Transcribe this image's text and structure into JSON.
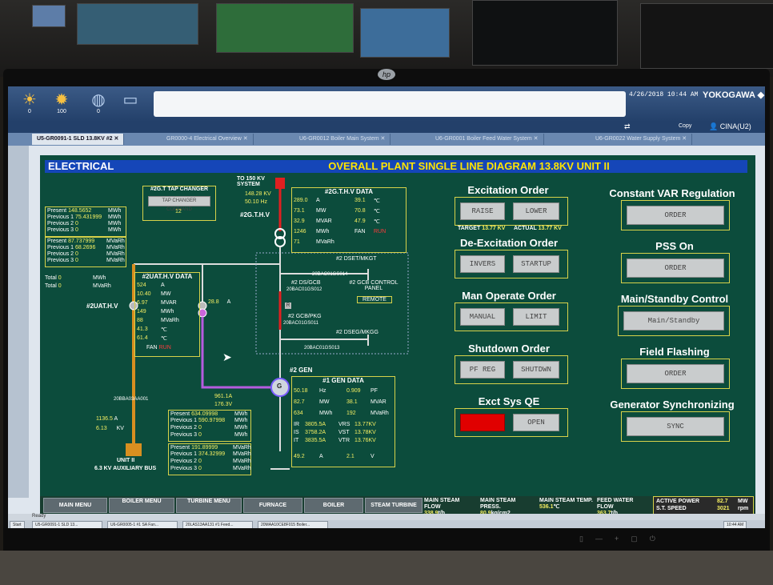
{
  "app": {
    "brand": "YOKOGAWA ◆",
    "clock": "4/26/2018 10:44 AM",
    "copy_label": "Copy",
    "user": "CINA(U2)",
    "toolbar": [
      {
        "icon": "alarm-sun-icon",
        "value": "0"
      },
      {
        "icon": "alarm-sun-icon",
        "value": "100"
      },
      {
        "icon": "operator-icon",
        "value": "0"
      },
      {
        "icon": "message-icon",
        "value": ""
      }
    ]
  },
  "tabs": [
    {
      "label": "U5-GR0091-1 SLD 13.8KV #2 ✕",
      "active": true
    },
    {
      "label": "GR0000-4 Electrical Overview ✕",
      "active": false
    },
    {
      "label": "U6-GR0012 Boiler Main System ✕",
      "active": false
    },
    {
      "label": "U6-GR0001 Boiler Feed Water System ✕",
      "active": false
    },
    {
      "label": "U6-GR0022 Water Supply System ✕",
      "active": false
    }
  ],
  "graphic": {
    "header_left": "ELECTRICAL",
    "header_title": "OVERALL PLANT SINGLE LINE DIAGRAM 13.8KV UNIT II",
    "top_system": "TO 150 KV SYSTEM",
    "top_kv": "148.28",
    "top_kv_unit": "KV",
    "top_hz": "50.10",
    "top_hz_unit": "Hz",
    "gthv_label": "#2G.T.H.V",
    "tap": {
      "title": "#2G.T TAP CHANGER",
      "button": "TAP CHANGER COMMAND",
      "value": "12"
    },
    "energy_mwh": [
      {
        "label": "Present",
        "value": "148.5652",
        "unit": "MWh"
      },
      {
        "label": "Previous 1",
        "value": "75.431999",
        "unit": "MWh"
      },
      {
        "label": "Previous 2",
        "value": "0",
        "unit": "MWh"
      },
      {
        "label": "Previous 3",
        "value": "0",
        "unit": "MWh"
      }
    ],
    "energy_mvarh": [
      {
        "label": "Present",
        "value": "87.737999",
        "unit": "MVaRh"
      },
      {
        "label": "Previous 1",
        "value": "68.2696",
        "unit": "MVaRh"
      },
      {
        "label": "Previous 2",
        "value": "0",
        "unit": "MVaRh"
      },
      {
        "label": "Previous 3",
        "value": "0",
        "unit": "MVaRh"
      }
    ],
    "totals": [
      {
        "label": "Total",
        "value": "0",
        "unit": "MWh"
      },
      {
        "label": "Total",
        "value": "0",
        "unit": "MVaRh"
      }
    ],
    "gthv_data": {
      "title": "#2G.T.H.V DATA",
      "rows": [
        {
          "v1": "289.0",
          "u1": "A",
          "v2": "39.1",
          "u2": "℃"
        },
        {
          "v1": "73.1",
          "u1": "MW",
          "v2": "70.8",
          "u2": "℃"
        },
        {
          "v1": "32.9",
          "u1": "MVAR",
          "v2": "47.9",
          "u2": "℃"
        },
        {
          "v1": "1246",
          "u1": "MWh",
          "v2": "FAN",
          "u2": "RUN"
        },
        {
          "v1": "71",
          "u1": "MVaRh",
          "v2": "",
          "u2": ""
        }
      ]
    },
    "uathv_data": {
      "title": "#2UAT.H.V DATA",
      "rows": [
        {
          "v": "524",
          "u": "A"
        },
        {
          "v": "10.40",
          "u": "MW"
        },
        {
          "v": "6.97",
          "u": "MVAR"
        },
        {
          "v": "149",
          "u": "MWh"
        },
        {
          "v": "88",
          "u": "MVaRh"
        },
        {
          "v": "41.3",
          "u": "℃"
        },
        {
          "v": "61.4",
          "u": "℃"
        },
        {
          "v": "FAN",
          "u": "RUN"
        }
      ]
    },
    "uathv_label": "#2UAT.H.V",
    "aux_current": "28.8",
    "aux_current_unit": "A",
    "switch_labels": {
      "dset": "#2 DSET/MKGT",
      "ds_gcb": "#2 DS/GCB",
      "ds_gcb_tag": "20BAC01GS012",
      "ds_tag": "20BAC01GS014",
      "gcb_title": "#2 GCB CONTROL PANEL",
      "remote": "REMOTE",
      "gcb_pkg": "#2 GCB/PKG",
      "gcb_tag": "20BAC01GS011",
      "dseg": "#2 DSEG/MKGG",
      "dseg_tag": "20BAC01GS013",
      "r_tag": "R"
    },
    "gen_label": "#2 GEN",
    "gen_symbol": "G",
    "aux_bus": {
      "tag": "20BBA03AA001",
      "current": "1136.5",
      "current_unit": "A",
      "kv": "6.13",
      "kv_unit": "KV",
      "label1": "UNIT II",
      "label2": "6.3 KV AUXILIARY BUS"
    },
    "excitation": {
      "current": "961.1A",
      "voltage": "176.3V"
    },
    "gen_mwh": [
      {
        "label": "Present",
        "value": "634.09998",
        "unit": "MWh"
      },
      {
        "label": "Previous 1",
        "value": "590.97998",
        "unit": "MWh"
      },
      {
        "label": "Previous 2",
        "value": "0",
        "unit": "MWh"
      },
      {
        "label": "Previous 3",
        "value": "0",
        "unit": "MWh"
      }
    ],
    "gen_mvarh": [
      {
        "label": "Present",
        "value": "191.89999",
        "unit": "MVaRh"
      },
      {
        "label": "Previous 1",
        "value": "374.32999",
        "unit": "MVaRh"
      },
      {
        "label": "Previous 2",
        "value": "0",
        "unit": "MVaRh"
      },
      {
        "label": "Previous 3",
        "value": "0",
        "unit": "MVaRh"
      }
    ],
    "gen_data": {
      "title": "#1 GEN DATA",
      "rows": [
        {
          "v1": "50.18",
          "u1": "Hz",
          "v2": "0.909",
          "u2": "PF"
        },
        {
          "v1": "82.7",
          "u1": "MW",
          "v2": "38.1",
          "u2": "MVAR"
        },
        {
          "v1": "634",
          "u1": "MWh",
          "v2": "192",
          "u2": "MVaRh"
        }
      ],
      "phase": [
        {
          "a": "IR",
          "b": "3805.5A",
          "c": "VRS",
          "d": "13.77KV"
        },
        {
          "a": "IS",
          "b": "3758.2A",
          "c": "VST",
          "d": "13.78KV"
        },
        {
          "a": "IT",
          "b": "3835.5A",
          "c": "VTR",
          "d": "13.76KV"
        }
      ],
      "last": {
        "v1": "49.2",
        "u1": "A",
        "v2": "2.1",
        "u2": "V"
      }
    },
    "orders": {
      "excitation": {
        "title": "Excitation Order",
        "b1": "RAISE",
        "b2": "LOWER",
        "target_label": "TARGET",
        "target": "13.77 KV",
        "actual_label": "ACTUAL",
        "actual": "13.77 KV"
      },
      "deexcitation": {
        "title": "De-Excitation Order",
        "b1": "INVERS",
        "b2": "STARTUP"
      },
      "manop": {
        "title": "Man Operate Order",
        "b1": "MANUAL",
        "b2": "LIMIT"
      },
      "shutdown": {
        "title": "Shutdown Order",
        "b1": "PF REG",
        "b2": "SHUTDWN"
      },
      "exctsys": {
        "title": "Exct Sys QE",
        "b1": "",
        "b2": "OPEN"
      },
      "constvar": {
        "title": "Constant VAR Regulation",
        "b": "ORDER"
      },
      "pss": {
        "title": "PSS On",
        "b": "ORDER"
      },
      "mainstandby": {
        "title": "Main/Standby Control",
        "b": "Main/Standby"
      },
      "fieldflash": {
        "title": "Field Flashing",
        "b": "ORDER"
      },
      "gensync": {
        "title": "Generator Synchronizing",
        "b": "SYNC"
      }
    },
    "colors": {
      "panel": "#0c4c3c",
      "header": "#1546b8",
      "title_yellow": "#ffe400",
      "alarm_red": "#e00000"
    }
  },
  "menu": {
    "buttons": [
      "MAIN MENU",
      "BOILER MENU",
      "TURBINE MENU",
      "FURNACE",
      "BOILER",
      "STEAM TURBINE"
    ],
    "stats": [
      {
        "label": "MAIN STEAM FLOW",
        "value": "338.9",
        "unit": "t/h"
      },
      {
        "label": "MAIN STEAM PRESS.",
        "value": "80.9",
        "unit": "kg/cm2"
      },
      {
        "label": "MAIN STEAM TEMP.",
        "value": "536.1",
        "unit": "℃"
      },
      {
        "label": "FEED WATER FLOW",
        "value": "363.7",
        "unit": "t/h"
      }
    ],
    "active_power_label": "ACTIVE POWER",
    "active_power": "82.7",
    "active_power_unit": "MW",
    "speed_label": "S.T. SPEED",
    "speed": "3021",
    "speed_unit": "rpm"
  },
  "status": "Ready",
  "taskbar": {
    "start": "Start",
    "tasks": [
      "U5-GR0091-1 SLD 13...",
      "U6-GR0005-1 #1 SA Fan...",
      "20LAS13AA131 #1 Feed...",
      "20MAA10CE8F015 Boiler..."
    ],
    "time": "10:44 AM"
  }
}
